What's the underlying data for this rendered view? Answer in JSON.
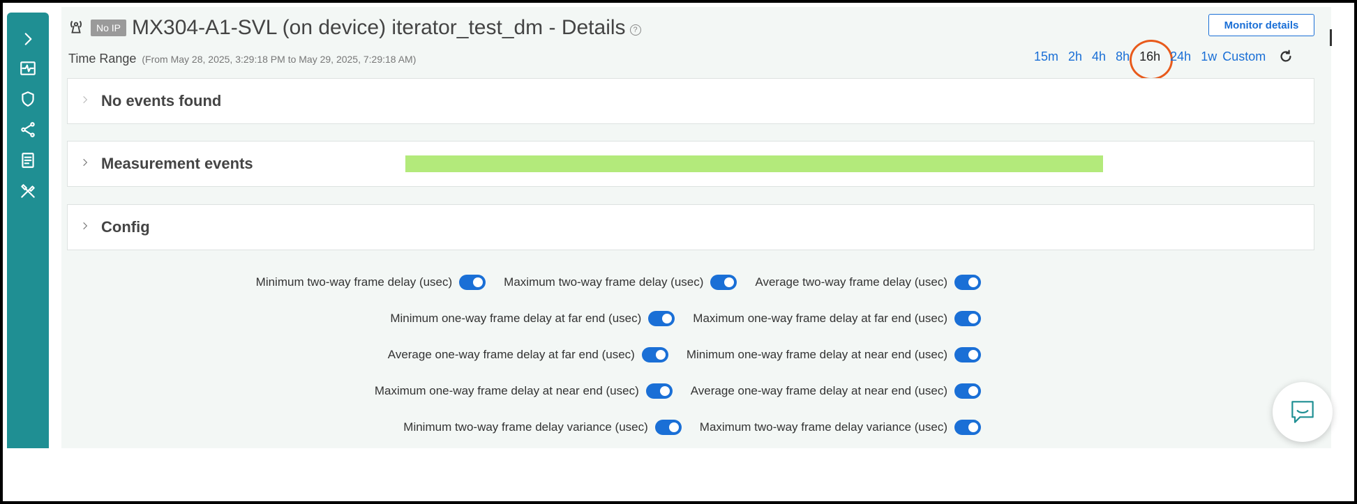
{
  "header": {
    "badge": "No IP",
    "title": "MX304-A1-SVL (on device) iterator_test_dm - Details",
    "help": "?",
    "monitor_button": "Monitor details"
  },
  "time_range": {
    "label": "Time Range",
    "span": "(From May 28, 2025, 3:29:18 PM to May 29, 2025, 7:29:18 AM)",
    "options": [
      "15m",
      "2h",
      "4h",
      "8h",
      "16h",
      "24h",
      "1w",
      "Custom"
    ],
    "selected": "16h"
  },
  "panels": {
    "events": "No events found",
    "measurement": "Measurement events",
    "config": "Config"
  },
  "toggles": [
    [
      "Minimum two-way frame delay (usec)",
      "Maximum two-way frame delay (usec)",
      "Average two-way frame delay (usec)"
    ],
    [
      "Minimum one-way frame delay at far end (usec)",
      "Maximum one-way frame delay at far end (usec)"
    ],
    [
      "Average one-way frame delay at far end (usec)",
      "Minimum one-way frame delay at near end (usec)"
    ],
    [
      "Maximum one-way frame delay at near end (usec)",
      "Average one-way frame delay at near end (usec)"
    ],
    [
      "Minimum two-way frame delay variance (usec)",
      "Maximum two-way frame delay variance (usec)"
    ]
  ],
  "colors": {
    "sidebar": "#1f8f93",
    "accent": "#1a6fd6",
    "measure_bar": "#b3ea7b",
    "highlight": "#e85a1b"
  },
  "icons": {
    "sidebar": [
      "chevron-right-icon",
      "activity-icon",
      "shield-icon",
      "share-icon",
      "document-icon",
      "tools-icon"
    ],
    "chat": "chat-icon"
  }
}
